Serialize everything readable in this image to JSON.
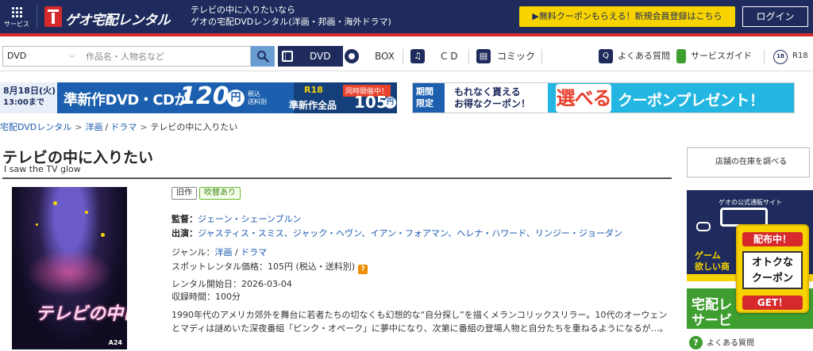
{
  "header": {
    "service_label": "サービス",
    "logo_text": "ゲオ宅配レンタル",
    "tagline_1": "テレビの中に入りたいなら",
    "tagline_2": "ゲオの宅配DVDレンタル(洋画・邦画・海外ドラマ)",
    "promo_label": "▶無料クーポンもらえる！新規会員登録はこちら",
    "login_label": "ログイン"
  },
  "nav": {
    "category_value": "DVD",
    "search_placeholder": "作品名・人物名など",
    "tabs": [
      {
        "label": "DVD"
      },
      {
        "label": "BOX"
      },
      {
        "label": "C D"
      },
      {
        "label": "コミック"
      }
    ],
    "faq_label": "よくある質問",
    "guide_label": "サービスガイド",
    "r18_icon_text": "18",
    "r18_label": "R18"
  },
  "banner1": {
    "date_1": "8月18日(火)",
    "date_2": "13:00まで",
    "main": "準新作DVD・CDが",
    "price": "120",
    "yen": "円",
    "tax_1": "税込",
    "tax_2": "送料別",
    "r18": "R18",
    "same_time": "同時開催中！",
    "sub": "準新作全品",
    "price2": "105",
    "yen2": "円"
  },
  "banner2": {
    "tag": "期間限定",
    "text_1": "もれなく貰える",
    "text_2": "お得なクーポン！",
    "select": "選べる",
    "main": "クーポンプレゼント！"
  },
  "breadcrumb": {
    "items": [
      "宅配DVDレンタル",
      "洋画",
      "ドラマ"
    ],
    "sep": "/",
    "current": "テレビの中に入りたい"
  },
  "title": {
    "main": "テレビの中に入りたい",
    "sub": "I saw the TV glow"
  },
  "poster": {
    "title": "テレビの中に入りたい",
    "logo": "A24"
  },
  "badges": {
    "old": "旧作",
    "dub": "吹替あり"
  },
  "info": {
    "director_key": "監督：",
    "director": "ジェーン・シェーンブルン",
    "cast_key": "出演：",
    "cast": "ジャスティス・スミス、ジャック・ヘヴン、イアン・フォアマン、ヘレナ・ハワード、リンジー・ジョーダン",
    "genre_key": "ジャンル：",
    "genre_1": "洋画",
    "genre_sep": " / ",
    "genre_2": "ドラマ",
    "price_key": "スポットレンタル価格：",
    "price": "105円 (税込・送料別)",
    "start_key": "レンタル開始日：",
    "start": "2026-03-04",
    "time_key": "収録時間：",
    "time": "100分",
    "description": "1990年代のアメリカ郊外を舞台に若者たちの切なくも幻想的な“自分探し”を描くメランコリックスリラー。10代のオーウェンとマディは謎めいた深夜番組「ピンク・オペーク」に夢中になり、次第に番組の登場人物と自分たちを重ねるようになるが…。"
  },
  "sidebar": {
    "store_label": "店舗の在庫を調べる",
    "geo_title": "ゲオの公式通販サイト",
    "geo_on": "オン",
    "geo_game_1": "ゲーム",
    "geo_game_2": "欲しい商",
    "green_1": "宅配レ",
    "green_2": "サービ",
    "faq_label": "よくある質問"
  },
  "coupon": {
    "line1": "配布中！",
    "line2a": "オトクな",
    "line2b": "クーポン",
    "line3": "GET！"
  },
  "colors": {
    "navy": "#1e2b5c",
    "red": "#d5292c",
    "yellow": "#f7d300",
    "link": "#1c5bb0",
    "green": "#3e9e2f"
  }
}
